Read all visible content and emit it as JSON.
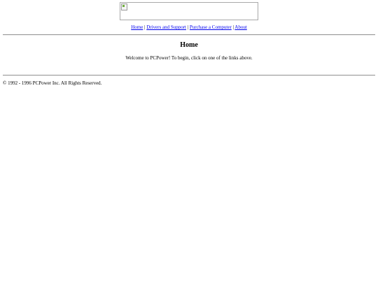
{
  "header": {
    "banner_icon": "broken-image-icon"
  },
  "nav": {
    "links": [
      {
        "label": "Home"
      },
      {
        "label": "Drivers and Support"
      },
      {
        "label": "Purchase a Computer"
      },
      {
        "label": "About"
      }
    ],
    "separator": " | "
  },
  "main": {
    "title": "Home",
    "welcome_text": "Welcome to PCPower! To begin, click on one of the links above."
  },
  "footer": {
    "copyright": "© 1992 - 1996 PCPower Inc. All Rights Reserved."
  },
  "colors": {
    "link": "#0000ee",
    "background": "#ffffff",
    "text": "#000000"
  }
}
